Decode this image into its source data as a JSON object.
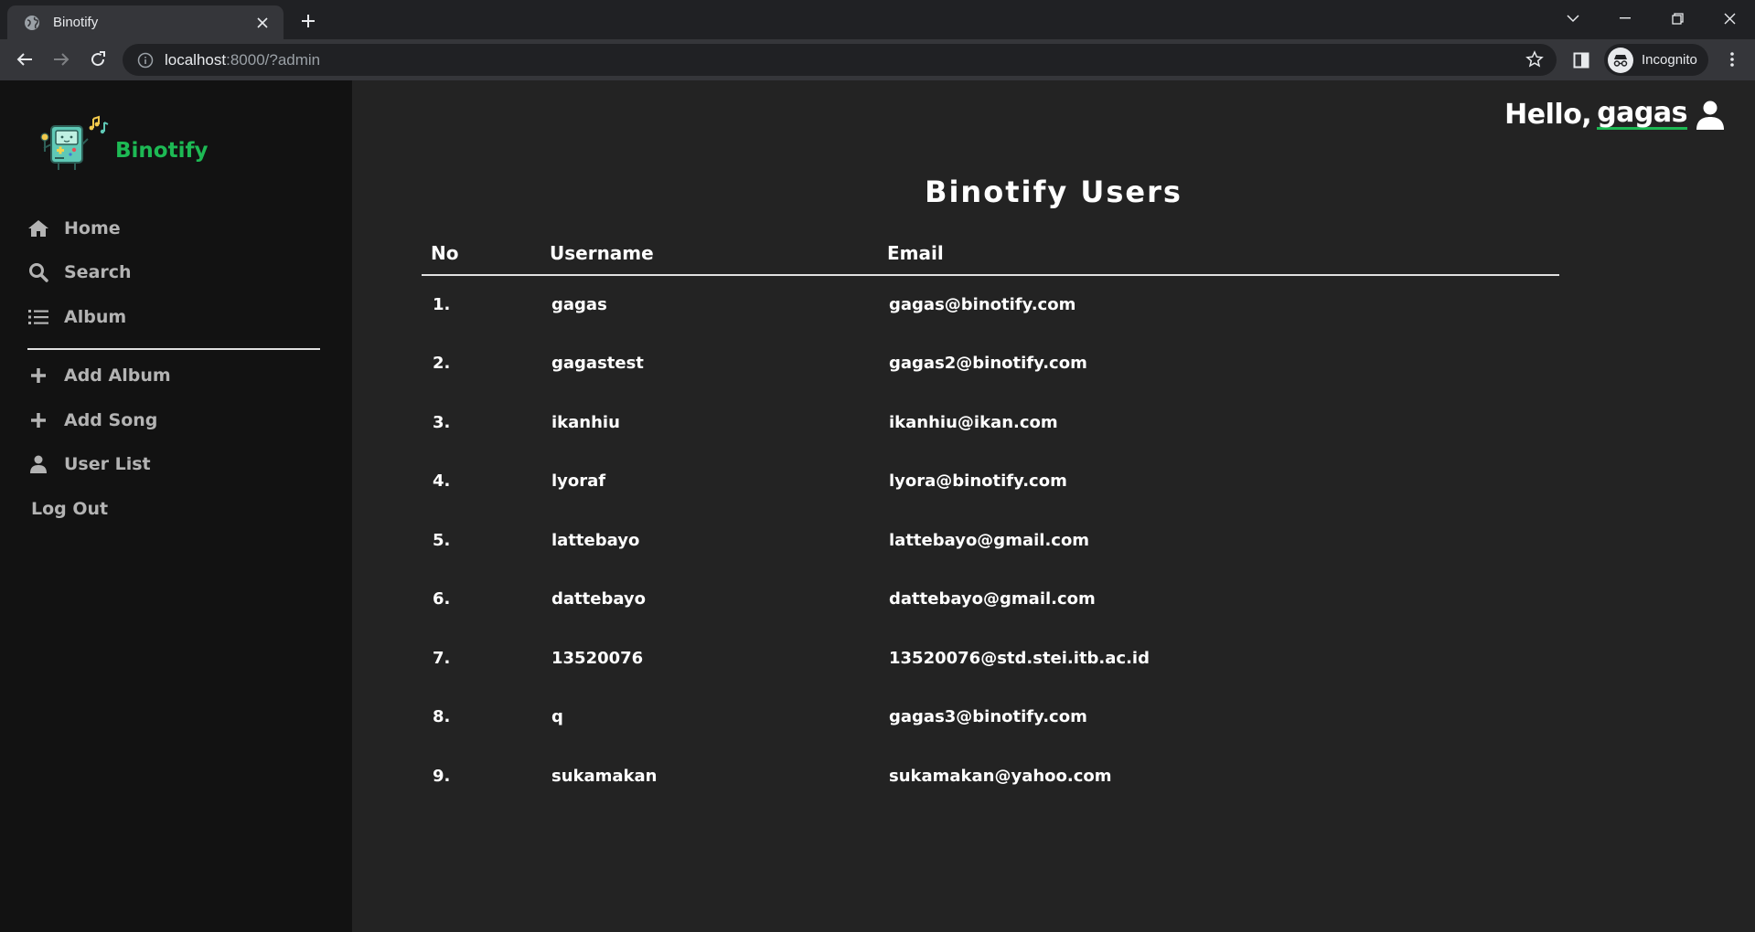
{
  "browser": {
    "tab_title": "Binotify",
    "url_host": "localhost",
    "url_rest": ":8000/?admin",
    "profile_label": "Incognito"
  },
  "sidebar": {
    "brand": "Binotify",
    "nav": [
      {
        "label": "Home",
        "icon": "home-icon"
      },
      {
        "label": "Search",
        "icon": "search-icon"
      },
      {
        "label": "Album",
        "icon": "list-icon"
      }
    ],
    "admin_nav": [
      {
        "label": "Add Album",
        "icon": "plus-icon"
      },
      {
        "label": "Add Song",
        "icon": "plus-icon"
      },
      {
        "label": "User List",
        "icon": "user-icon"
      }
    ],
    "logout": "Log Out"
  },
  "header": {
    "hello": "Hello,",
    "username": "gagas"
  },
  "main": {
    "title": "Binotify Users",
    "columns": [
      "No",
      "Username",
      "Email"
    ],
    "rows": [
      {
        "no": "1.",
        "username": "gagas",
        "email": "gagas@binotify.com"
      },
      {
        "no": "2.",
        "username": "gagastest",
        "email": "gagas2@binotify.com"
      },
      {
        "no": "3.",
        "username": "ikanhiu",
        "email": "ikanhiu@ikan.com"
      },
      {
        "no": "4.",
        "username": "lyoraf",
        "email": "lyora@binotify.com"
      },
      {
        "no": "5.",
        "username": "lattebayo",
        "email": "lattebayo@gmail.com"
      },
      {
        "no": "6.",
        "username": "dattebayo",
        "email": "dattebayo@gmail.com"
      },
      {
        "no": "7.",
        "username": "13520076",
        "email": "13520076@std.stei.itb.ac.id"
      },
      {
        "no": "8.",
        "username": "q",
        "email": "gagas3@binotify.com"
      },
      {
        "no": "9.",
        "username": "sukamakan",
        "email": "sukamakan@yahoo.com"
      }
    ]
  },
  "colors": {
    "accent": "#1db954",
    "sidebar_bg": "#121212",
    "main_bg": "#232323"
  }
}
